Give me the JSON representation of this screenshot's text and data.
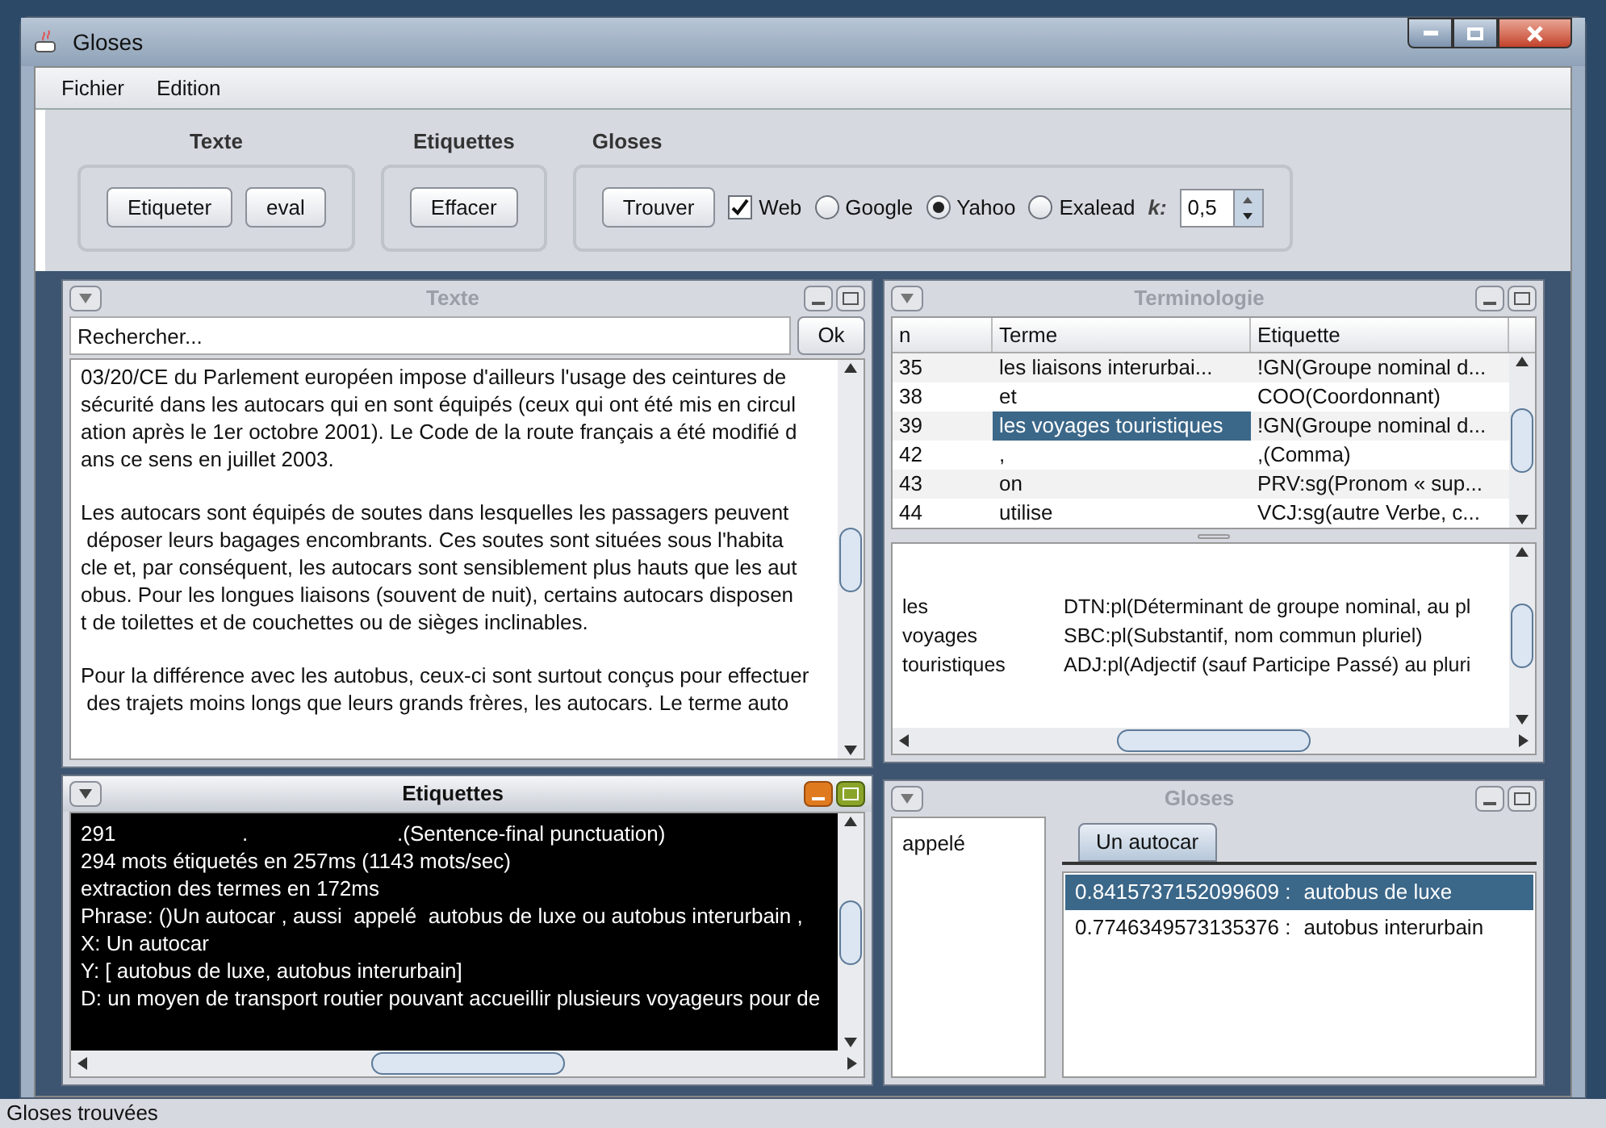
{
  "window": {
    "title": "Gloses"
  },
  "menu": [
    "Fichier",
    "Edition"
  ],
  "toolbar": {
    "groups": [
      {
        "title": "Texte",
        "items": [
          {
            "kind": "button",
            "label": "Etiqueter"
          },
          {
            "kind": "button",
            "label": "eval"
          }
        ]
      },
      {
        "title": "Etiquettes",
        "items": [
          {
            "kind": "button",
            "label": "Effacer"
          }
        ]
      },
      {
        "title": "Gloses",
        "items": [
          {
            "kind": "button",
            "label": "Trouver"
          },
          {
            "kind": "checkbox",
            "label": "Web",
            "checked": true
          },
          {
            "kind": "radio",
            "label": "Google",
            "selected": false
          },
          {
            "kind": "radio",
            "label": "Yahoo",
            "selected": true
          },
          {
            "kind": "radio",
            "label": "Exalead",
            "selected": false
          },
          {
            "kind": "spinner",
            "label": "k:",
            "value": "0,5"
          }
        ]
      }
    ]
  },
  "texte_panel": {
    "title": "Texte",
    "active": false,
    "search": {
      "placeholder": "Rechercher..."
    },
    "ok_button": "Ok",
    "paragraphs": [
      [
        "03/20/CE du Parlement européen impose d'ailleurs l'usage des ceintures de",
        "sécurité dans les autocars qui en sont équipés (ceux qui ont été mis en circul",
        "ation après le 1er octobre 2001). Le Code de la route français a été modifié d",
        "ans ce sens en juillet 2003."
      ],
      [
        "Les autocars sont équipés de soutes dans lesquelles les passagers peuvent",
        " déposer leurs bagages encombrants. Ces soutes sont situées sous l'habita",
        "cle et, par conséquent, les autocars sont sensiblement plus hauts que les aut",
        "obus. Pour les longues liaisons (souvent de nuit), certains autocars disposen",
        "t de toilettes et de couchettes ou de sièges inclinables."
      ],
      [
        "Pour la différence avec les autobus, ceux-ci sont surtout conçus pour effectuer",
        " des trajets moins longs que leurs grands frères, les autocars. Le terme auto"
      ]
    ]
  },
  "terminologie_panel": {
    "title": "Terminologie",
    "active": false,
    "table": {
      "columns": [
        "n",
        "Terme",
        "Etiquette"
      ],
      "rows": [
        {
          "n": "35",
          "terme": "les liaisons interurbai...",
          "etiquette": "!GN(Groupe nominal d...",
          "selected": false
        },
        {
          "n": "38",
          "terme": "et",
          "etiquette": "COO(Coordonnant)",
          "selected": false
        },
        {
          "n": "39",
          "terme": "les voyages touristiques",
          "etiquette": "!GN(Groupe nominal d...",
          "selected": true
        },
        {
          "n": "42",
          "terme": ",",
          "etiquette": ",(Comma)",
          "selected": false
        },
        {
          "n": "43",
          "terme": "on",
          "etiquette": "PRV:sg(Pronom « sup...",
          "selected": false
        },
        {
          "n": "44",
          "terme": "utilise",
          "etiquette": "VCJ:sg(autre Verbe, c...",
          "selected": false
        }
      ]
    },
    "details": [
      {
        "word": "les",
        "tag": "DTN:pl(Déterminant de groupe nominal, au pl"
      },
      {
        "word": "voyages",
        "tag": "SBC:pl(Substantif, nom commun pluriel)"
      },
      {
        "word": "touristiques",
        "tag": "ADJ:pl(Adjectif (sauf Participe Passé) au pluri"
      }
    ]
  },
  "etiquettes_panel": {
    "title": "Etiquettes",
    "active": true,
    "first_line": [
      "291",
      ".",
      ".(Sentence-final punctuation)"
    ],
    "lines": [
      "294 mots étiquetés en 257ms (1143 mots/sec)",
      "extraction des termes en 172ms",
      "Phrase: ()Un autocar , aussi  appelé  autobus de luxe ou autobus interurbain ,",
      "X: Un autocar",
      "Y: [ autobus de luxe, autobus interurbain]",
      "D: un moyen de transport routier pouvant accueillir plusieurs voyageurs pour de"
    ]
  },
  "gloses_panel": {
    "title": "Gloses",
    "active": false,
    "words": [
      "appelé"
    ],
    "tabs": [
      {
        "label": "Un autocar",
        "selected": true
      }
    ],
    "results": [
      {
        "score": "0.8415737152099609 :",
        "text": "autobus de luxe",
        "selected": true
      },
      {
        "score": "0.7746349573135376 :",
        "text": "autobus interurbain",
        "selected": false
      }
    ]
  },
  "status_bar": "Gloses trouvées"
}
